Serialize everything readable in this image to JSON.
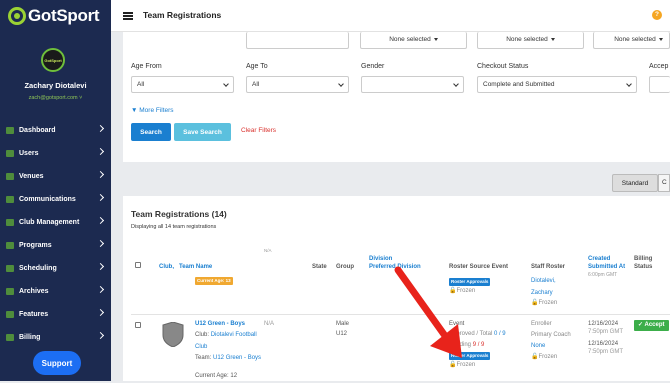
{
  "brand": {
    "name": "GotSport",
    "accent": "#9bd234",
    "sidebar_bg": "#1c2a50"
  },
  "user": {
    "avatar_text": "GotSport",
    "name": "Zachary Diotalevi",
    "email": "zach@gotsport.com ˅"
  },
  "nav": [
    {
      "label": "Dashboard",
      "icon": "dashboard-icon"
    },
    {
      "label": "Users",
      "icon": "users-icon"
    },
    {
      "label": "Venues",
      "icon": "venues-icon"
    },
    {
      "label": "Communications",
      "icon": "communications-icon"
    },
    {
      "label": "Club Management",
      "icon": "club-management-icon"
    },
    {
      "label": "Programs",
      "icon": "programs-icon"
    },
    {
      "label": "Scheduling",
      "icon": "scheduling-icon"
    },
    {
      "label": "Archives",
      "icon": "archives-icon"
    },
    {
      "label": "Features",
      "icon": "features-icon"
    },
    {
      "label": "Billing",
      "icon": "billing-icon"
    }
  ],
  "support_label": "Support",
  "header": {
    "title": "Team Registrations",
    "help": "?"
  },
  "filters": {
    "top_row": [
      "None selected",
      "None selected",
      "None selected"
    ],
    "age_from": {
      "label": "Age From",
      "value": "All"
    },
    "age_to": {
      "label": "Age To",
      "value": "All"
    },
    "gender": {
      "label": "Gender",
      "value": ""
    },
    "checkout_status": {
      "label": "Checkout Status",
      "value": "Complete and Submitted"
    },
    "accept_label": "Accep",
    "more_filters": "More Filters",
    "search": "Search",
    "save_search": "Save Search",
    "clear": "Clear Filters"
  },
  "view_toggle": {
    "standard": "Standard",
    "other": "C"
  },
  "table": {
    "title": "Team Registrations (14)",
    "subtitle": "Displaying all 14 team registrations",
    "columns": {
      "club": "Club",
      "team_name": "Team Name",
      "na": "N/A",
      "state": "State",
      "group": "Group",
      "division_line1": "Division",
      "division_line2": "Preferred Division",
      "roster_source": "Roster Source Event",
      "staff_roster": "Staff Roster",
      "created_line1": "Created",
      "created_line2": "Submitted At",
      "billing_line1": "Billing",
      "billing_line2": "Status"
    },
    "row1": {
      "age_badge": "Current Age: 13",
      "roster_badge": "Roster Approvals",
      "frozen": "Frozen",
      "staff": [
        "Diotalevi,",
        "Zachary"
      ],
      "staff_frozen": "Frozen",
      "time": "6:00pm GMT"
    },
    "row2": {
      "team": "U12 Green - Boys",
      "club_prefix": "Club:",
      "club": "Diotalevi Football Club",
      "team_prefix": "Team:",
      "team_link": "U12 Green - Boys",
      "current_age": "Current Age: 12",
      "na": "N/A",
      "group_line1": "Male",
      "group_line2": "U12",
      "event": "Event",
      "approved_prefix": "Approved / Total",
      "approved_value": "0 / 9",
      "pending_prefix": "Pending",
      "pending_value": "9 / 9",
      "roster_badge": "Roster Approvals",
      "frozen": "Frozen",
      "staff_line1": "Enroller",
      "staff_line2": "Primary Coach",
      "staff_none": "None",
      "staff_frozen": "Frozen",
      "created_date": "12/16/2024",
      "created_time": "7:50pm GMT",
      "submitted_date": "12/16/2024",
      "submitted_time": "7:50pm GMT",
      "billing_badge": "Accept"
    }
  }
}
